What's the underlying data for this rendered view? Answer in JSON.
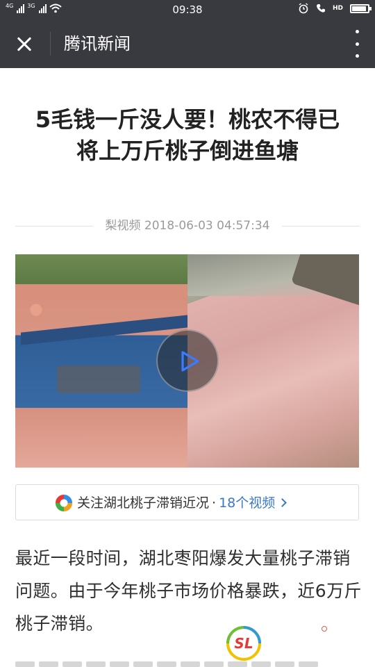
{
  "status_bar": {
    "network_left": "4G",
    "network_right": "3G",
    "time": "09:38",
    "hd": "HD",
    "battery_level": 0.9
  },
  "nav": {
    "title": "腾讯新闻",
    "close_icon": "close-icon",
    "more_icon": "more-vertical-icon"
  },
  "article": {
    "title": "5毛钱一斤没人要！桃农不得已将上万斤桃子倒进鱼塘",
    "source": "梨视频",
    "datetime": "2018-06-03 04:57:34",
    "body": "最近一段时间，湖北枣阳爆发大量桃子滞销问题。由于今年桃子市场价格暴跌，近6万斤桃子滞销。"
  },
  "video": {
    "play_icon": "play-icon"
  },
  "related": {
    "label": "关注湖北桃子滞销近况",
    "separator": "·",
    "count": "18个视频",
    "logo_icon": "tencent-news-logo-icon",
    "chevron_icon": "chevron-right-icon"
  },
  "watermark": {
    "text": "SL"
  },
  "colors": {
    "nav_bg": "#393a3f",
    "link_blue": "#3a78c6"
  }
}
